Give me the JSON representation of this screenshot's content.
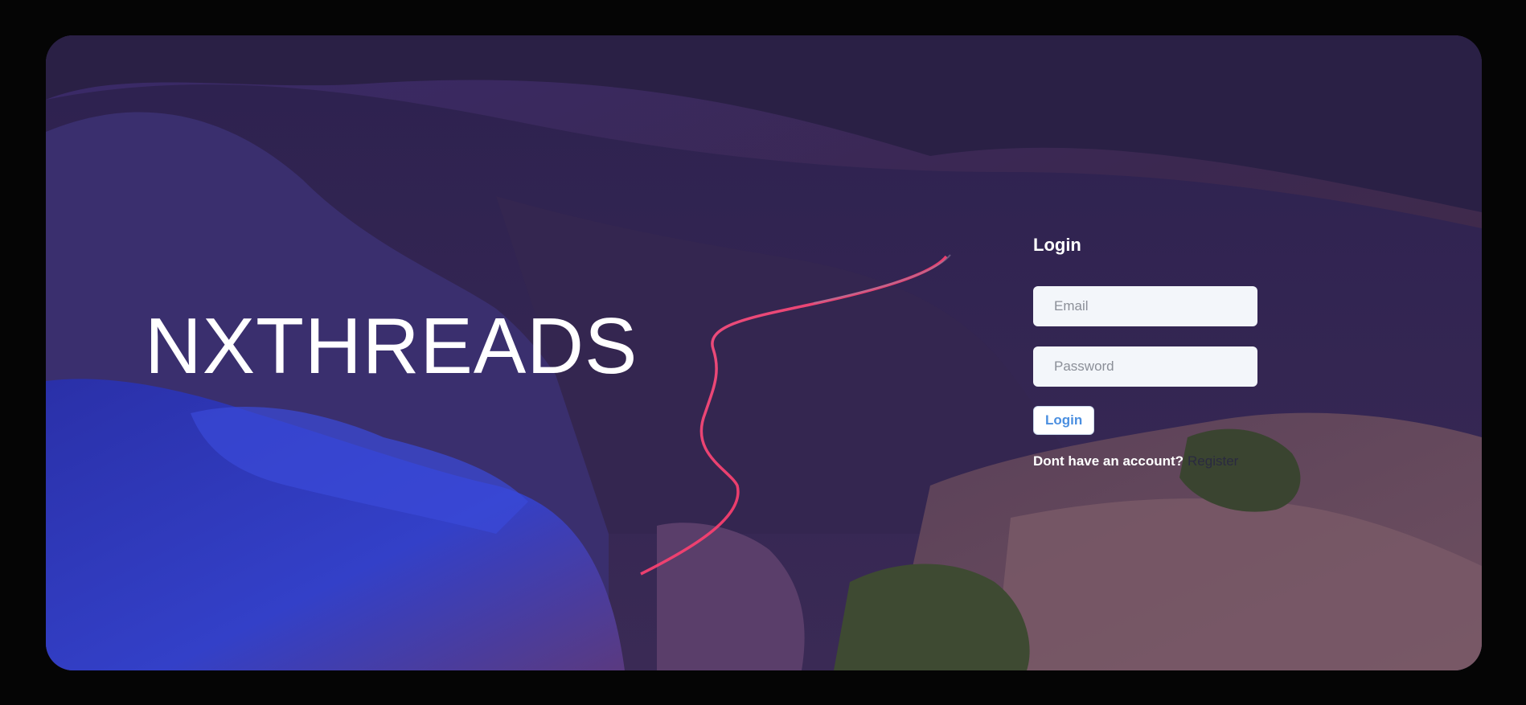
{
  "brand": {
    "name": "NXTHREADS"
  },
  "login": {
    "title": "Login",
    "email_placeholder": "Email",
    "password_placeholder": "Password",
    "button_label": "Login",
    "no_account_text": "Dont have an account?",
    "register_link": "Register"
  },
  "colors": {
    "page_background": "#050505",
    "button_text": "#4b8fe0",
    "input_background": "#f3f6fa"
  }
}
